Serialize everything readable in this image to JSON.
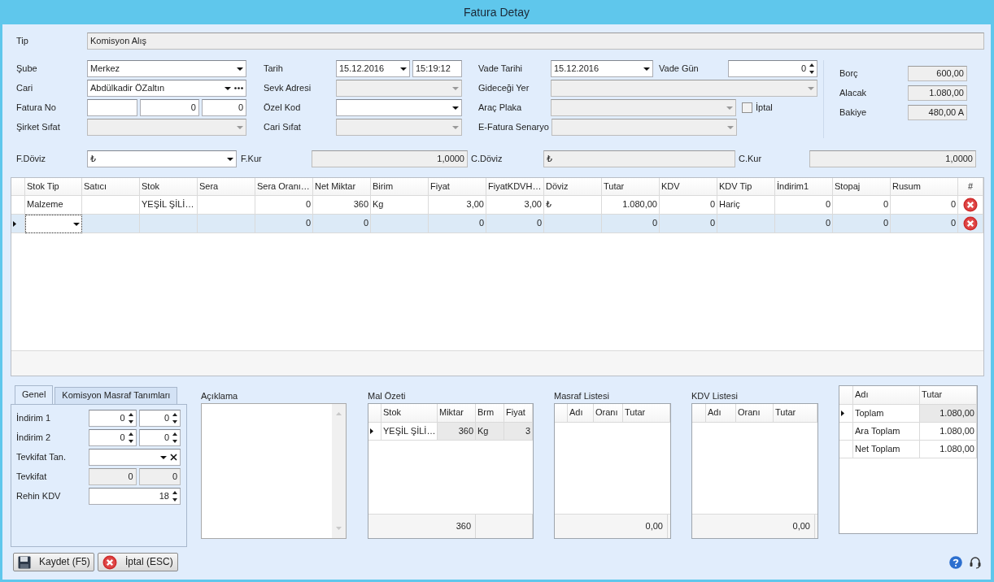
{
  "window": {
    "title": "Fatura Detay"
  },
  "tip": {
    "label": "Tip",
    "value": "Komisyon Alış"
  },
  "field_columns": [
    [
      {
        "label": "Şube",
        "parts": [
          {
            "kind": "combo",
            "value": "Merkez",
            "disabled": false
          }
        ]
      },
      {
        "label": "Cari",
        "parts": [
          {
            "kind": "lookup",
            "value": "Abdülkadir ÖZaltın",
            "disabled": false
          }
        ]
      },
      {
        "label": "Fatura No",
        "parts": [
          {
            "kind": "text",
            "disabled": false
          },
          {
            "kind": "number",
            "value": "0",
            "disabled": false
          },
          {
            "kind": "number",
            "value": "0",
            "disabled": false
          }
        ]
      },
      {
        "label": "Şirket Sıfat",
        "parts": [
          {
            "kind": "combo",
            "disabled": true
          }
        ]
      }
    ],
    [
      {
        "label": "Tarih",
        "parts": [
          {
            "kind": "date",
            "value": "15.12.2016",
            "disabled": false
          },
          {
            "kind": "time",
            "value": "15:19:12",
            "disabled": false
          }
        ]
      },
      {
        "label": "Sevk Adresi",
        "parts": [
          {
            "kind": "combo",
            "disabled": true
          }
        ]
      },
      {
        "label": "Özel Kod",
        "parts": [
          {
            "kind": "combo",
            "disabled": false
          }
        ]
      },
      {
        "label": "Cari Sıfat",
        "parts": [
          {
            "kind": "combo",
            "disabled": true
          }
        ]
      }
    ],
    [
      {
        "label": "Vade Tarihi",
        "parts": [
          {
            "kind": "date",
            "value": "15.12.2016",
            "disabled": false
          },
          {
            "kind": "label",
            "text": "Vade Gün"
          },
          {
            "kind": "spin",
            "value": "0",
            "disabled": false
          }
        ]
      },
      {
        "label": "Gideceği Yer",
        "parts": [
          {
            "kind": "combo",
            "disabled": true
          }
        ]
      },
      {
        "label": "Araç Plaka",
        "parts": [
          {
            "kind": "combo",
            "disabled": true
          },
          {
            "kind": "checkbox",
            "text": "İptal",
            "checked": false
          }
        ]
      },
      {
        "label": "E-Fatura Senaryo",
        "parts": [
          {
            "kind": "combo",
            "disabled": true
          }
        ]
      }
    ]
  ],
  "balances": [
    {
      "label": "Borç",
      "value": "600,00"
    },
    {
      "label": "Alacak",
      "value": "1.080,00"
    },
    {
      "label": "Bakiye",
      "value": "480,00 A"
    }
  ],
  "currency_row": [
    {
      "label": "F.Döviz",
      "kind": "combo",
      "value": "₺",
      "disabled": false
    },
    {
      "label": "F.Kur",
      "kind": "number",
      "value": "1,0000",
      "disabled": true
    },
    {
      "label": "C.Döviz",
      "kind": "text",
      "value": "₺",
      "disabled": true
    },
    {
      "label": "C.Kur",
      "kind": "number",
      "value": "1,0000",
      "disabled": true
    }
  ],
  "items_grid": {
    "columns": [
      "Stok Tip",
      "Satıcı",
      "Stok",
      "Sera",
      "Sera Oranı…",
      "Net Miktar",
      "Birim",
      "Fiyat",
      "FiyatKDVH…",
      "Döviz",
      "Tutar",
      "KDV",
      "KDV Tip",
      "İndirim1",
      "Stopaj",
      "Rusum",
      "#"
    ],
    "rows": [
      {
        "selected": false,
        "cells": [
          "Malzeme",
          null,
          "YEŞİL ŞİLİ…",
          null,
          "0",
          "360",
          "Kg",
          "3,00",
          "3,00",
          "₺",
          "1.080,00",
          "0",
          "Hariç",
          "0",
          "0",
          "0"
        ]
      },
      {
        "selected": true,
        "cells": [
          null,
          null,
          null,
          null,
          "0",
          "0",
          null,
          "0",
          "0",
          null,
          "0",
          "0",
          null,
          "0",
          "0",
          "0"
        ]
      }
    ]
  },
  "tabs": [
    {
      "label": "Genel",
      "selected": true
    },
    {
      "label": "Komisyon Masraf Tanımları",
      "selected": false
    }
  ],
  "genel_fields": [
    {
      "label": "İndirim 1",
      "parts": [
        {
          "kind": "spin",
          "value": "0",
          "disabled": false
        },
        {
          "kind": "spin",
          "value": "0",
          "disabled": false
        }
      ]
    },
    {
      "label": "İndirim 2",
      "parts": [
        {
          "kind": "spin",
          "value": "0",
          "disabled": false
        },
        {
          "kind": "spin",
          "value": "0",
          "disabled": false
        }
      ]
    },
    {
      "label": "Tevkifat Tan.",
      "parts": [
        {
          "kind": "clearcombo",
          "disabled": false
        }
      ]
    },
    {
      "label": "Tevkifat",
      "parts": [
        {
          "kind": "number",
          "value": "0",
          "disabled": true
        },
        {
          "kind": "number",
          "value": "0",
          "disabled": true
        }
      ]
    },
    {
      "label": "Rehin KDV",
      "parts": [
        {
          "kind": "spin",
          "value": "18",
          "disabled": false
        }
      ]
    }
  ],
  "aciklama": {
    "label": "Açıklama"
  },
  "mal_ozeti": {
    "title": "Mal Özeti",
    "columns": [
      "Stok",
      "Miktar",
      "Brm",
      "Fiyat"
    ],
    "rows": [
      {
        "selected": true,
        "cells": [
          "YEŞİL ŞİLİ…",
          "360",
          "Kg",
          "3"
        ]
      }
    ],
    "footer": [
      "360"
    ]
  },
  "masraf_listesi": {
    "title": "Masraf Listesi",
    "columns": [
      "Adı",
      "Oranı",
      "Tutar"
    ],
    "footer": [
      "0,00"
    ]
  },
  "kdv_listesi": {
    "title": "KDV Listesi",
    "columns": [
      "Adı",
      "Oranı",
      "Tutar"
    ],
    "footer": [
      "0,00"
    ]
  },
  "totals": {
    "columns": [
      "Adı",
      "Tutar"
    ],
    "rows": [
      {
        "selected": true,
        "cells": [
          "Toplam",
          "1.080,00"
        ]
      },
      {
        "selected": false,
        "cells": [
          "Ara Toplam",
          "1.080,00"
        ]
      },
      {
        "selected": false,
        "cells": [
          "Net Toplam",
          "1.080,00"
        ]
      }
    ]
  },
  "buttons": [
    {
      "kind": "save",
      "label": "Kaydet (F5)"
    },
    {
      "kind": "cancel",
      "label": "İptal (ESC)"
    }
  ]
}
